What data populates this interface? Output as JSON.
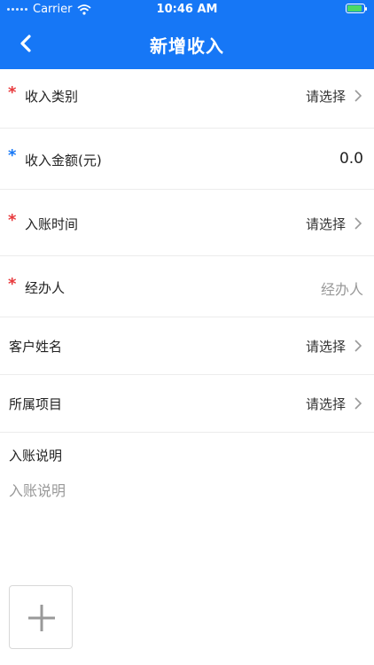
{
  "status_bar": {
    "carrier": "Carrier",
    "time": "10:46 AM"
  },
  "header": {
    "title": "新增收入"
  },
  "form": {
    "rows": [
      {
        "label": "收入类别",
        "value": "请选择",
        "required": true,
        "star_color": "#e8393c"
      },
      {
        "label": "收入金额(元)",
        "value": "0.0",
        "required": true,
        "star_color": "#1677f6"
      },
      {
        "label": "入账时间",
        "value": "请选择",
        "required": true,
        "star_color": "#e8393c"
      },
      {
        "label": "经办人",
        "placeholder": "经办人",
        "required": true,
        "star_color": "#e8393c"
      },
      {
        "label": "客户姓名",
        "value": "请选择",
        "required": false
      },
      {
        "label": "所属项目",
        "value": "请选择",
        "required": false
      }
    ],
    "description": {
      "label": "入账说明",
      "placeholder": "入账说明"
    },
    "required_marker": "*"
  },
  "colors": {
    "primary": "#1677f6",
    "required_red": "#e8393c"
  },
  "icons": {
    "back": "chevron-left-icon",
    "row_arrow": "chevron-right-icon",
    "add": "plus-icon",
    "wifi": "wifi-icon",
    "battery": "battery-icon"
  }
}
